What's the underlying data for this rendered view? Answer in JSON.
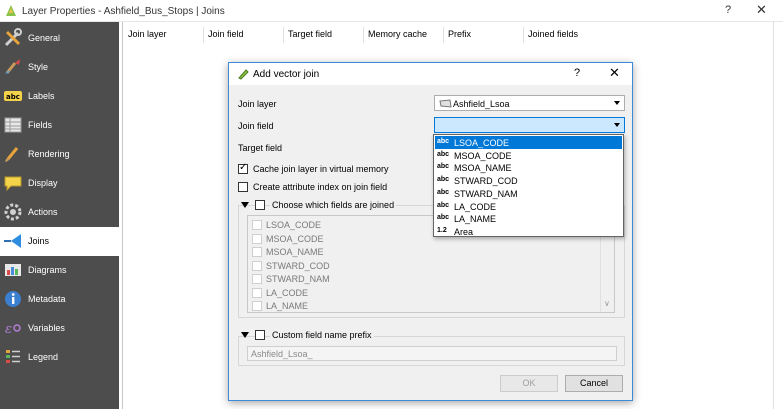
{
  "window": {
    "title": "Layer Properties - Ashfield_Bus_Stops | Joins",
    "help_label": "?",
    "close_label": "✕"
  },
  "sidebar": {
    "items": [
      {
        "label": "General",
        "icon": "wrench-screwdriver-icon"
      },
      {
        "label": "Style",
        "icon": "paintbrush-icon"
      },
      {
        "label": "Labels",
        "icon": "abc-labels-icon"
      },
      {
        "label": "Fields",
        "icon": "table-fields-icon"
      },
      {
        "label": "Rendering",
        "icon": "brush-icon"
      },
      {
        "label": "Display",
        "icon": "speech-bubble-icon"
      },
      {
        "label": "Actions",
        "icon": "gear-icon"
      },
      {
        "label": "Joins",
        "icon": "join-icon"
      },
      {
        "label": "Diagrams",
        "icon": "diagram-icon"
      },
      {
        "label": "Metadata",
        "icon": "info-icon"
      },
      {
        "label": "Variables",
        "icon": "variables-icon"
      },
      {
        "label": "Legend",
        "icon": "legend-icon"
      }
    ],
    "active": "Joins"
  },
  "joins_table": {
    "columns": [
      "Join layer",
      "Join field",
      "Target field",
      "Memory cache",
      "Prefix",
      "Joined fields"
    ]
  },
  "dialog": {
    "title": "Add vector join",
    "help_label": "?",
    "close_label": "✕",
    "join_layer_label": "Join layer",
    "join_layer_value": "Ashfield_Lsoa",
    "join_field_label": "Join field",
    "join_field_value": "",
    "target_field_label": "Target field",
    "cache_label": "Cache join layer in virtual memory",
    "cache_checked": true,
    "index_label": "Create attribute index on join field",
    "index_checked": false,
    "choose_fields_label": "Choose which fields are joined",
    "choose_fields_checked": false,
    "field_list": [
      "LSOA_CODE",
      "MSOA_CODE",
      "MSOA_NAME",
      "STWARD_COD",
      "STWARD_NAM",
      "LA_CODE",
      "LA_NAME"
    ],
    "custom_prefix_label": "Custom field name prefix",
    "custom_prefix_checked": false,
    "prefix_value": "Ashfield_Lsoa_",
    "ok_label": "OK",
    "cancel_label": "Cancel"
  },
  "dropdown": {
    "options": [
      {
        "type": "abc",
        "label": "LSOA_CODE"
      },
      {
        "type": "abc",
        "label": "MSOA_CODE"
      },
      {
        "type": "abc",
        "label": "MSOA_NAME"
      },
      {
        "type": "abc",
        "label": "STWARD_COD"
      },
      {
        "type": "abc",
        "label": "STWARD_NAM"
      },
      {
        "type": "abc",
        "label": "LA_CODE"
      },
      {
        "type": "abc",
        "label": "LA_NAME"
      },
      {
        "type": "1.2",
        "label": "Area"
      }
    ],
    "selected": "LSOA_CODE"
  },
  "colors": {
    "sidebar_bg": "#4d4d4d",
    "selection": "#0078d7",
    "focus_bg": "#cce8ff"
  }
}
